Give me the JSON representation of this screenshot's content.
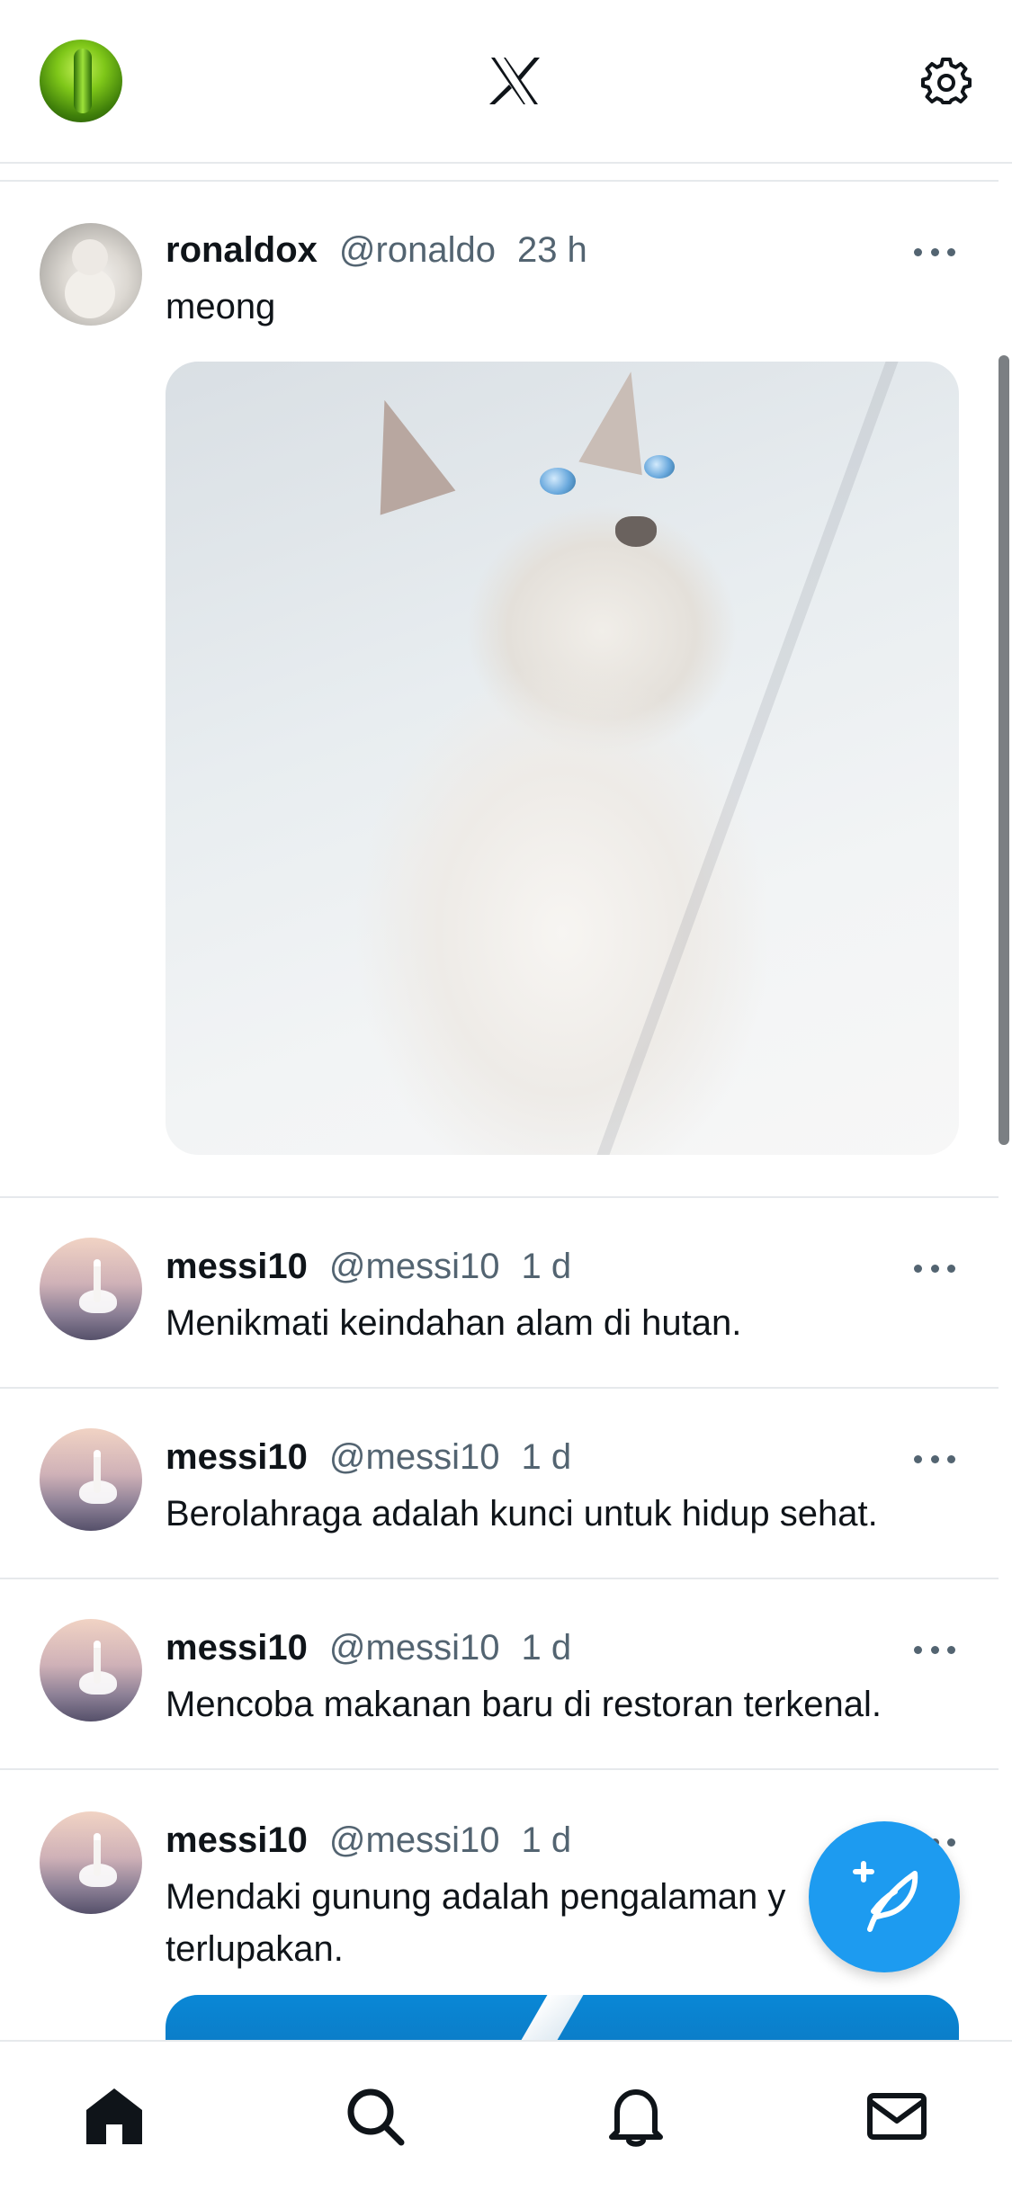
{
  "app": {
    "brand_icon": "x-logo-icon",
    "settings_icon": "gear-icon"
  },
  "tweets": [
    {
      "name": "ronaldox",
      "handle": "@ronaldo",
      "time": "23 h",
      "text": "meong",
      "avatar": "kitten-photo",
      "media": "kitten-photo"
    },
    {
      "name": "messi10",
      "handle": "@messi10",
      "time": "1 d",
      "text": "Menikmati keindahan alam di hutan.",
      "avatar": "swan-photo"
    },
    {
      "name": "messi10",
      "handle": "@messi10",
      "time": "1 d",
      "text": "Berolahraga adalah kunci untuk hidup sehat.",
      "avatar": "swan-photo"
    },
    {
      "name": "messi10",
      "handle": "@messi10",
      "time": "1 d",
      "text": "Mencoba makanan baru di restoran terkenal.",
      "avatar": "swan-photo"
    },
    {
      "name": "messi10",
      "handle": "@messi10",
      "time": "1 d",
      "text": "Mendaki gunung adalah pengalaman y terlupakan.",
      "avatar": "swan-photo",
      "media": "blue-photo"
    }
  ],
  "compose": {
    "icon": "compose-feather-icon",
    "color": "#1d9bf0"
  },
  "tabbar": {
    "items": [
      "home-icon",
      "search-icon",
      "bell-icon",
      "mail-icon"
    ]
  },
  "colors": {
    "text": "#0f1419",
    "secondary": "#536471",
    "border": "#e6e9ec",
    "accent": "#1d9bf0"
  }
}
